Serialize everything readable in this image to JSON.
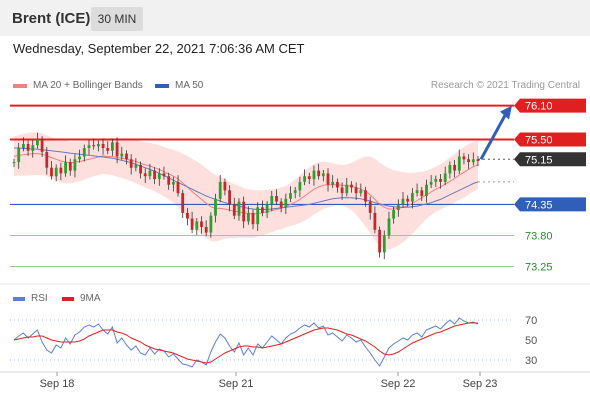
{
  "header": {
    "title": "Brent (ICE)",
    "timeframe": "30 MIN"
  },
  "datetime": "Wednesday, September 22, 2021 7:06:36 AM CET",
  "legend": {
    "ma20": "MA 20 + Bollinger Bands",
    "ma50": "MA 50",
    "credit": "Research © 2021 Trading Central"
  },
  "colors": {
    "resistance": "#e02020",
    "support_blue": "#2f5fb8",
    "support_green": "#2e8b2e",
    "current": "#333333",
    "bollinger": "#fde0de",
    "rsi": "#5b7fdc",
    "rsi_ma": "#e02020",
    "arrow": "#2f5fb8"
  },
  "chart_data": [
    {
      "type": "candlestick",
      "x_ticks": [
        "Sep 18",
        "Sep 21",
        "Sep 22",
        "Sep 23"
      ],
      "ylim": [
        73.1,
        76.2
      ],
      "levels": [
        {
          "label": "76.10",
          "value": 76.1,
          "kind": "resistance"
        },
        {
          "label": "75.50",
          "value": 75.5,
          "kind": "resistance"
        },
        {
          "label": "75.15",
          "value": 75.15,
          "kind": "current"
        },
        {
          "label": "74.35",
          "value": 74.35,
          "kind": "support"
        },
        {
          "label": "73.80",
          "value": 73.8,
          "kind": "support"
        },
        {
          "label": "73.25",
          "value": 73.25,
          "kind": "support"
        }
      ],
      "close": [
        75.1,
        75.35,
        75.42,
        75.3,
        75.4,
        75.5,
        75.28,
        75.0,
        74.85,
        75.0,
        74.9,
        75.1,
        74.95,
        75.15,
        75.2,
        75.35,
        75.4,
        75.38,
        75.42,
        75.35,
        75.3,
        75.45,
        75.2,
        75.25,
        75.15,
        75.0,
        75.05,
        74.9,
        74.85,
        74.95,
        74.8,
        74.9,
        74.85,
        74.7,
        74.75,
        74.55,
        74.2,
        74.1,
        73.9,
        74.05,
        73.95,
        73.85,
        74.15,
        74.45,
        74.75,
        74.6,
        74.35,
        74.15,
        74.4,
        74.05,
        74.2,
        74.0,
        74.3,
        74.2,
        74.35,
        74.5,
        74.4,
        74.3,
        74.45,
        74.55,
        74.6,
        74.75,
        74.85,
        74.8,
        74.95,
        74.85,
        74.9,
        74.7,
        74.75,
        74.65,
        74.55,
        74.7,
        74.65,
        74.55,
        74.6,
        74.4,
        74.2,
        73.9,
        73.5,
        73.8,
        74.1,
        74.25,
        74.35,
        74.45,
        74.4,
        74.55,
        74.6,
        74.5,
        74.7,
        74.75,
        74.8,
        74.75,
        74.9,
        75.05,
        74.95,
        75.2,
        75.15,
        75.1,
        75.15,
        75.12
      ],
      "ma20": [
        75.2,
        75.22,
        75.23,
        75.24,
        75.25,
        75.25,
        75.24,
        75.21,
        75.18,
        75.15,
        75.12,
        75.1,
        75.09,
        75.1,
        75.11,
        75.13,
        75.15,
        75.17,
        75.19,
        75.21,
        75.2,
        75.2,
        75.18,
        75.17,
        75.15,
        75.13,
        75.11,
        75.08,
        75.05,
        75.03,
        75.0,
        74.97,
        74.93,
        74.89,
        74.85,
        74.8,
        74.73,
        74.66,
        74.58,
        74.51,
        74.44,
        74.37,
        74.31,
        74.28,
        74.28,
        74.27,
        74.25,
        74.23,
        74.22,
        74.2,
        74.19,
        74.18,
        74.19,
        74.2,
        74.22,
        74.24,
        74.26,
        74.28,
        74.31,
        74.35,
        74.39,
        74.44,
        74.5,
        74.56,
        74.62,
        74.66,
        74.69,
        74.7,
        74.7,
        74.7,
        74.69,
        74.68,
        74.67,
        74.65,
        74.62,
        74.58,
        74.52,
        74.44,
        74.35,
        74.3,
        74.27,
        74.27,
        74.28,
        74.3,
        74.33,
        74.37,
        74.42,
        74.47,
        74.52,
        74.57,
        74.62,
        74.66,
        74.71,
        74.76,
        74.81,
        74.87,
        74.92,
        74.97,
        75.02,
        75.05
      ],
      "ma50": [
        75.35,
        75.35,
        75.34,
        75.34,
        75.33,
        75.33,
        75.32,
        75.31,
        75.3,
        75.29,
        75.28,
        75.27,
        75.26,
        75.25,
        75.24,
        75.23,
        75.22,
        75.21,
        75.2,
        75.19,
        75.18,
        75.17,
        75.15,
        75.13,
        75.11,
        75.09,
        75.06,
        75.03,
        75.0,
        74.97,
        74.94,
        74.9,
        74.86,
        74.82,
        74.78,
        74.74,
        74.7,
        74.66,
        74.62,
        74.58,
        74.54,
        74.5,
        74.47,
        74.44,
        74.41,
        74.38,
        74.36,
        74.34,
        74.32,
        74.3,
        74.28,
        74.27,
        74.26,
        74.26,
        74.26,
        74.27,
        74.28,
        74.29,
        74.3,
        74.31,
        74.32,
        74.33,
        74.34,
        74.35,
        74.37,
        74.39,
        74.41,
        74.43,
        74.45,
        74.46,
        74.47,
        74.47,
        74.47,
        74.46,
        74.45,
        74.43,
        74.41,
        74.38,
        74.36,
        74.34,
        74.32,
        74.31,
        74.3,
        74.3,
        74.3,
        74.31,
        74.32,
        74.34,
        74.36,
        74.38,
        74.41,
        74.44,
        74.48,
        74.52,
        74.56,
        74.6,
        74.64,
        74.68,
        74.72,
        74.75
      ],
      "band": [
        0.35,
        0.36,
        0.37,
        0.38,
        0.38,
        0.38,
        0.37,
        0.36,
        0.36,
        0.37,
        0.38,
        0.38,
        0.37,
        0.36,
        0.35,
        0.34,
        0.33,
        0.32,
        0.32,
        0.32,
        0.32,
        0.33,
        0.34,
        0.35,
        0.36,
        0.37,
        0.38,
        0.39,
        0.4,
        0.41,
        0.42,
        0.43,
        0.44,
        0.45,
        0.47,
        0.49,
        0.52,
        0.55,
        0.58,
        0.6,
        0.62,
        0.62,
        0.61,
        0.59,
        0.56,
        0.53,
        0.5,
        0.48,
        0.46,
        0.44,
        0.43,
        0.42,
        0.41,
        0.4,
        0.39,
        0.38,
        0.37,
        0.37,
        0.37,
        0.38,
        0.4,
        0.42,
        0.44,
        0.45,
        0.45,
        0.44,
        0.42,
        0.4,
        0.38,
        0.36,
        0.36,
        0.38,
        0.42,
        0.48,
        0.55,
        0.62,
        0.68,
        0.72,
        0.74,
        0.74,
        0.72,
        0.69,
        0.66,
        0.62,
        0.58,
        0.54,
        0.5,
        0.46,
        0.43,
        0.41,
        0.4,
        0.4,
        0.41,
        0.42,
        0.43,
        0.44,
        0.45,
        0.45,
        0.44,
        0.43
      ],
      "forecast_arrow": {
        "from": 75.15,
        "to": 76.1
      }
    },
    {
      "type": "line",
      "legend": [
        "RSI",
        "9MA"
      ],
      "ylim": [
        20,
        80
      ],
      "y_ticks": [
        "70",
        "50",
        "30"
      ],
      "rsi": [
        50,
        54,
        57,
        52,
        56,
        60,
        48,
        40,
        37,
        45,
        42,
        52,
        46,
        55,
        58,
        63,
        65,
        63,
        66,
        60,
        56,
        63,
        47,
        52,
        45,
        40,
        44,
        37,
        35,
        42,
        36,
        41,
        39,
        33,
        36,
        31,
        26,
        25,
        23,
        30,
        28,
        25,
        38,
        48,
        56,
        52,
        44,
        38,
        47,
        35,
        42,
        35,
        46,
        42,
        48,
        54,
        50,
        46,
        52,
        56,
        58,
        62,
        65,
        63,
        67,
        62,
        64,
        55,
        57,
        53,
        49,
        55,
        52,
        48,
        50,
        43,
        37,
        30,
        24,
        33,
        42,
        46,
        49,
        52,
        50,
        55,
        57,
        53,
        60,
        62,
        64,
        61,
        66,
        70,
        66,
        72,
        69,
        67,
        68,
        66
      ],
      "rsi_ma": [
        50,
        51,
        52,
        53,
        53,
        54,
        54,
        52,
        50,
        49,
        48,
        48,
        48,
        48,
        49,
        51,
        54,
        56,
        58,
        60,
        60,
        60,
        58,
        57,
        55,
        52,
        50,
        48,
        45,
        43,
        41,
        40,
        39,
        38,
        37,
        35,
        33,
        31,
        30,
        29,
        28,
        27,
        28,
        31,
        34,
        37,
        39,
        41,
        43,
        44,
        44,
        43,
        43,
        42,
        43,
        44,
        45,
        46,
        48,
        50,
        52,
        54,
        56,
        58,
        60,
        61,
        62,
        62,
        61,
        60,
        58,
        56,
        55,
        53,
        51,
        49,
        46,
        43,
        39,
        36,
        35,
        36,
        38,
        41,
        44,
        47,
        49,
        51,
        53,
        55,
        57,
        58,
        60,
        62,
        64,
        65,
        66,
        67,
        67,
        67
      ]
    }
  ]
}
